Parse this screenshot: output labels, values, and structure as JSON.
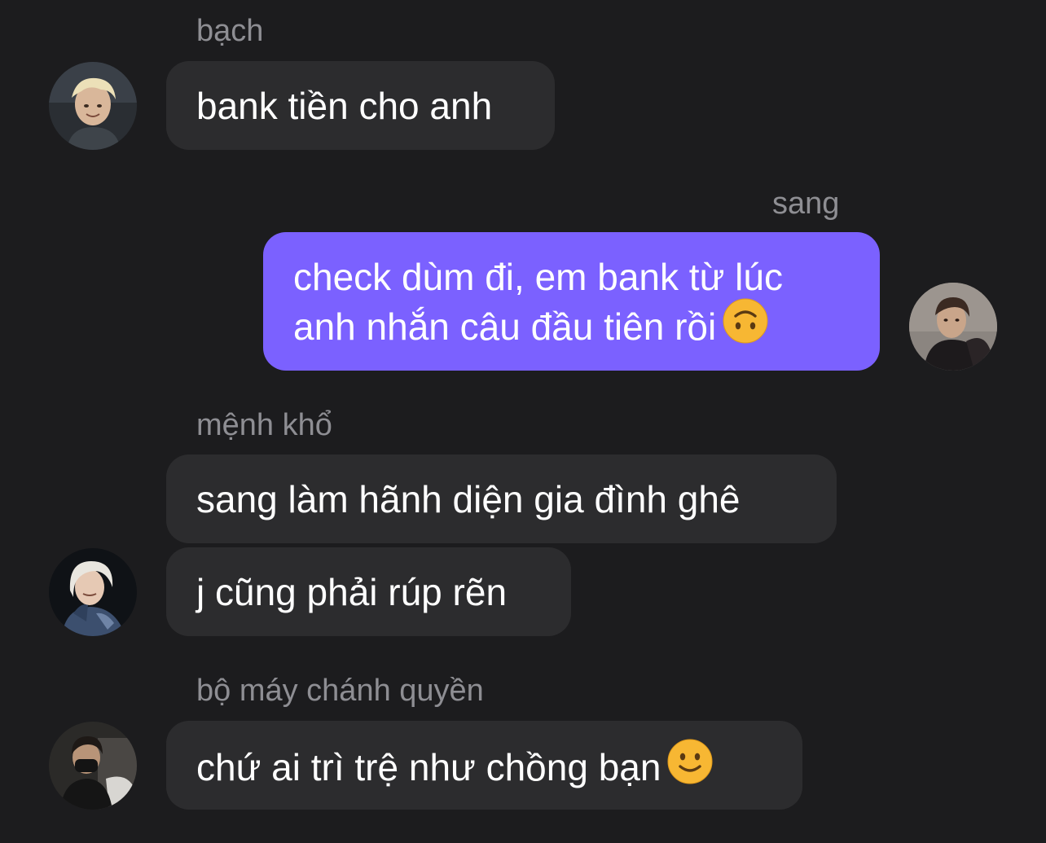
{
  "conversation": {
    "messages": [
      {
        "sender": "bạch",
        "lines": [
          "bank tiền cho anh"
        ],
        "avatar": "avatar-blonde-man-smiling"
      },
      {
        "sender": "sang",
        "lines": [
          "check dùm đi, em bank từ lúc",
          "anh nhắn câu đầu tiên rồi"
        ],
        "emoji": "upside-down-face-emoji",
        "avatar": "avatar-dark-hair-man"
      },
      {
        "sender": "mệnh khổ",
        "lines": [
          "sang làm hãnh diện gia đình ghê"
        ]
      },
      {
        "lines": [
          "j cũng phải rúp rẽn"
        ],
        "avatar": "avatar-blonde-smiling"
      },
      {
        "sender": "bộ máy chánh quyền",
        "lines": [
          "chứ ai trì trệ như chồng bạn"
        ],
        "emoji": "slightly-smiling-face-emoji",
        "avatar": "avatar-masked-man"
      }
    ]
  },
  "colors": {
    "background": "#1c1c1e",
    "incoming_bubble": "#2c2c2e",
    "outgoing_bubble": "#7b61ff",
    "sender_name": "#8e8e93"
  }
}
